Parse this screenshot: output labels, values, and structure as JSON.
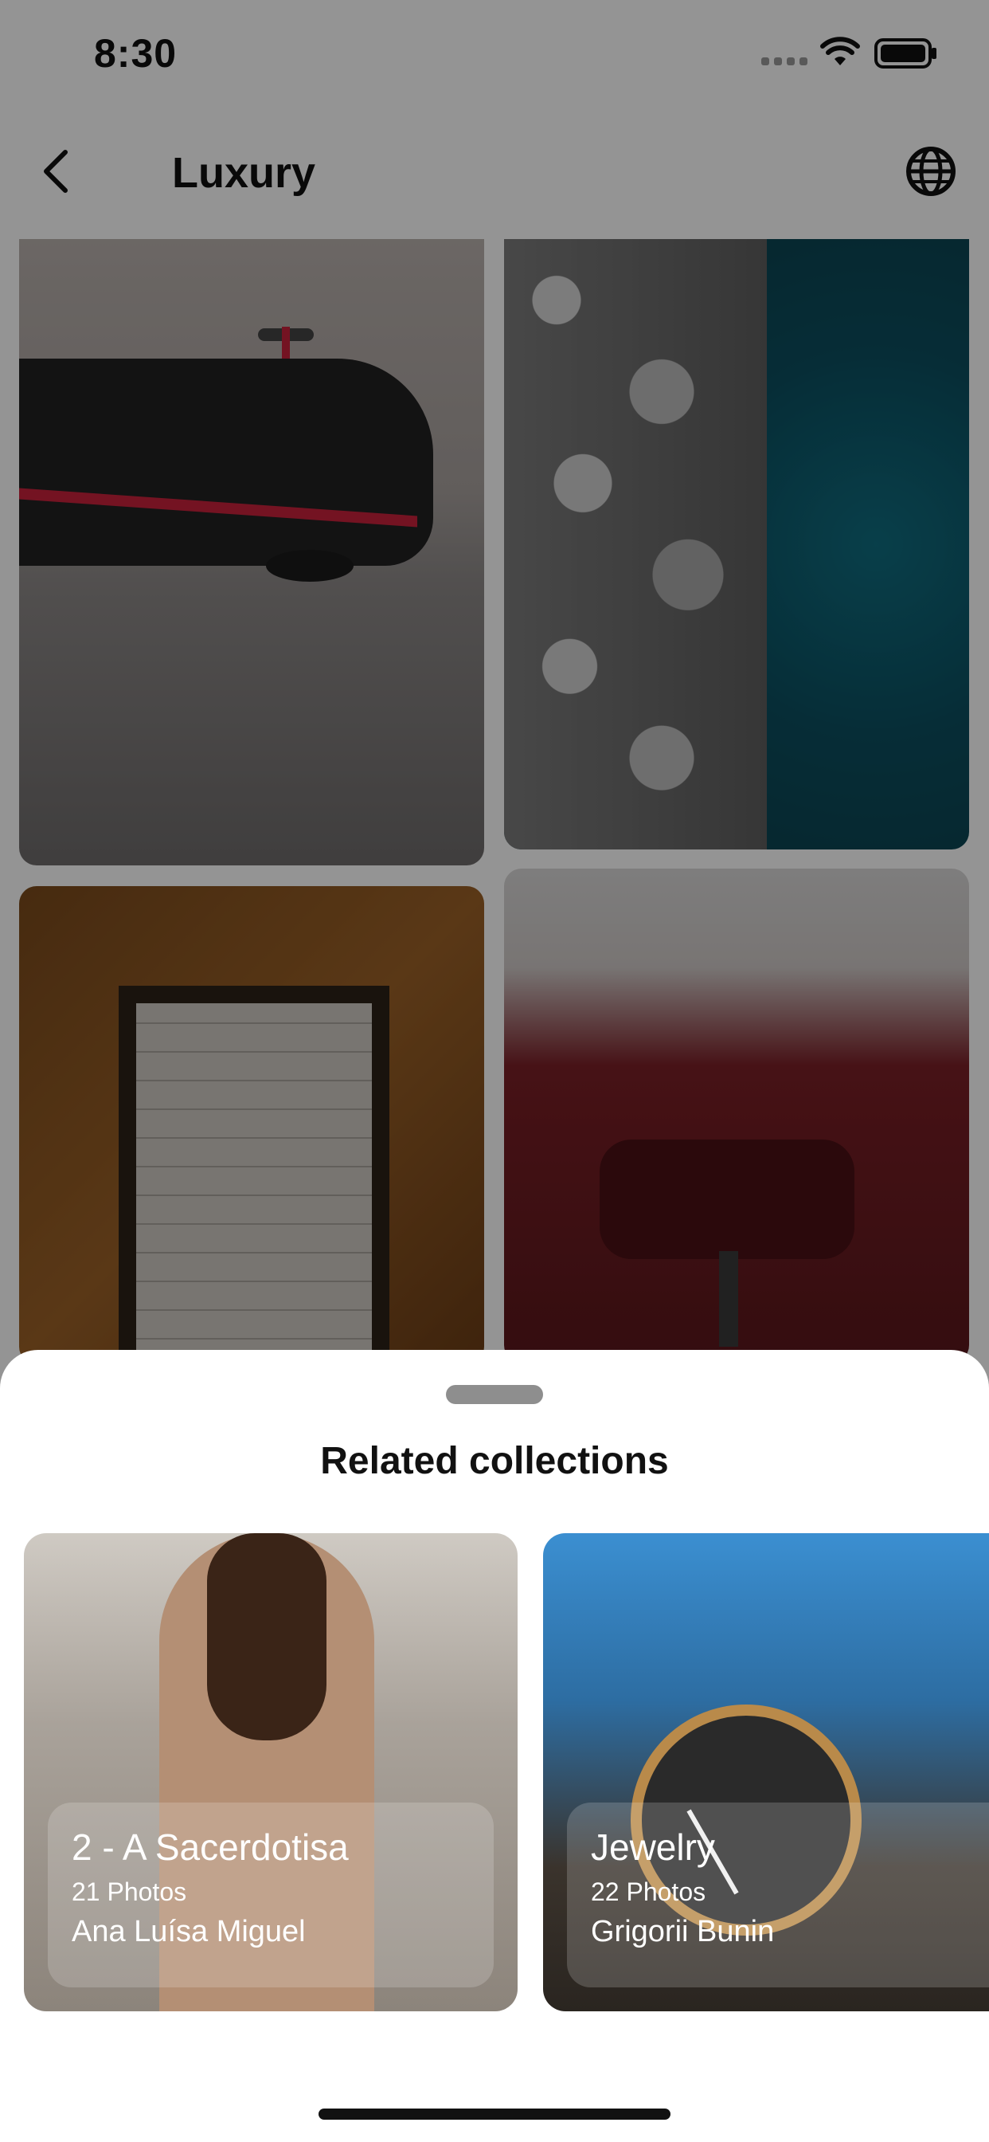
{
  "status_bar": {
    "time": "8:30"
  },
  "nav": {
    "title": "Luxury",
    "back_icon": "chevron-left-icon",
    "globe_icon": "globe-icon"
  },
  "sheet": {
    "title": "Related collections",
    "collections": [
      {
        "title": "2 - A Sacerdotisa",
        "count": "21 Photos",
        "author": "Ana Luísa Miguel"
      },
      {
        "title": "Jewelry",
        "count": "22 Photos",
        "author": "Grigorii Bunin"
      }
    ]
  },
  "colors": {
    "overlay": "#00000066",
    "sheet_bg": "#ffffff",
    "accent_red": "#c8213c"
  }
}
